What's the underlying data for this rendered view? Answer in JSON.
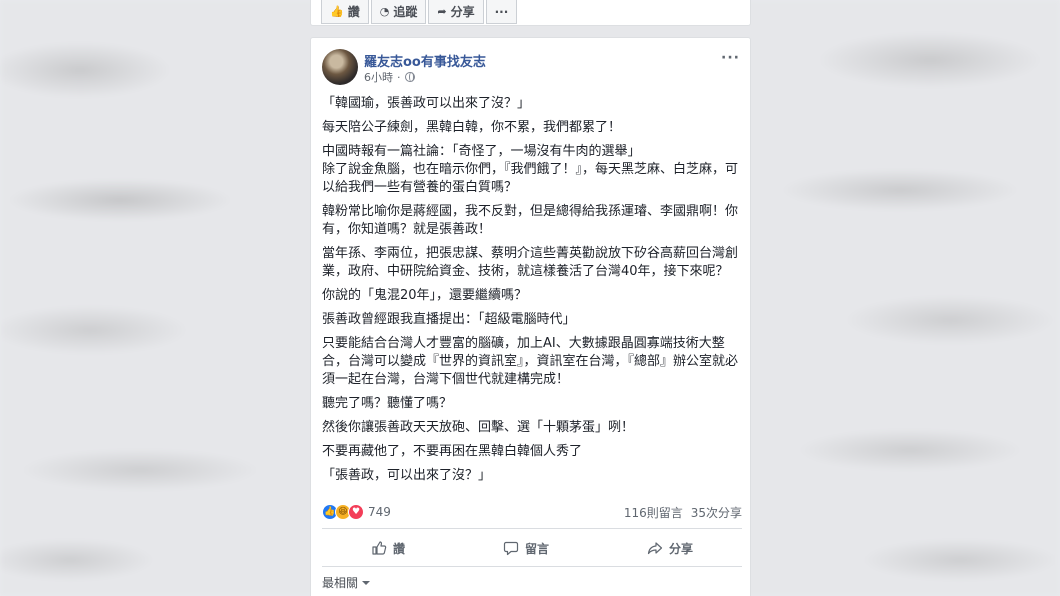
{
  "top_bar": {
    "like_label": "讚",
    "follow_label": "追蹤",
    "share_label": "分享",
    "more_label": "···"
  },
  "post": {
    "author": "羅友志oo有事找友志",
    "time": "6小時",
    "paragraphs": [
      "「韓國瑜，張善政可以出來了沒？」",
      "每天陪公子練劍，黑韓白韓，你不累，我們都累了！",
      "中國時報有一篇社論：「奇怪了，一場沒有牛肉的選舉」\n除了說金魚腦，也在暗示你們，『我們餓了！』，每天黑芝麻、白芝麻，可以給我們一些有營養的蛋白質嗎？",
      "韓粉常比喻你是蔣經國，我不反對，但是總得給我孫運璿、李國鼎啊！你有，你知道嗎？就是張善政！",
      "當年孫、李兩位，把張忠謀、蔡明介這些菁英勸說放下矽谷高薪回台灣創業，政府、中研院給資金、技術，就這樣養活了台灣40年，接下來呢？",
      "你說的「鬼混20年」，還要繼續嗎？",
      "張善政曾經跟我直播提出：「超級電腦時代」",
      "只要能結合台灣人才豐富的腦礦，加上AI、大數據跟晶圓寡端技術大整合，台灣可以變成『世界的資訊室』，資訊室在台灣，『總部』辦公室就必須一起在台灣，台灣下個世代就建構完成！",
      "聽完了嗎？聽懂了嗎？",
      "然後你讓張善政天天放砲、回擊、選「十顆茅蛋」咧！",
      "不要再藏他了，不要再困在黑韓白韓個人秀了",
      "「張善政，可以出來了沒？」"
    ],
    "reaction_count": "749",
    "comment_count": "116則留言",
    "share_count": "35次分享"
  },
  "actions": {
    "like": "讚",
    "comment": "留言",
    "share": "分享"
  },
  "comments": {
    "sort_label": "最相關"
  },
  "icons": {
    "like": "thumbs-up-icon",
    "follow": "rss-icon",
    "share": "share-arrow-icon",
    "comment": "speech-bubble-icon",
    "globe": "globe-icon",
    "more": "ellipsis-icon"
  },
  "colors": {
    "author_link": "#385898",
    "like_blue": "#2078f4",
    "love_red": "#f33e58",
    "haha_yellow": "#f7b125"
  }
}
